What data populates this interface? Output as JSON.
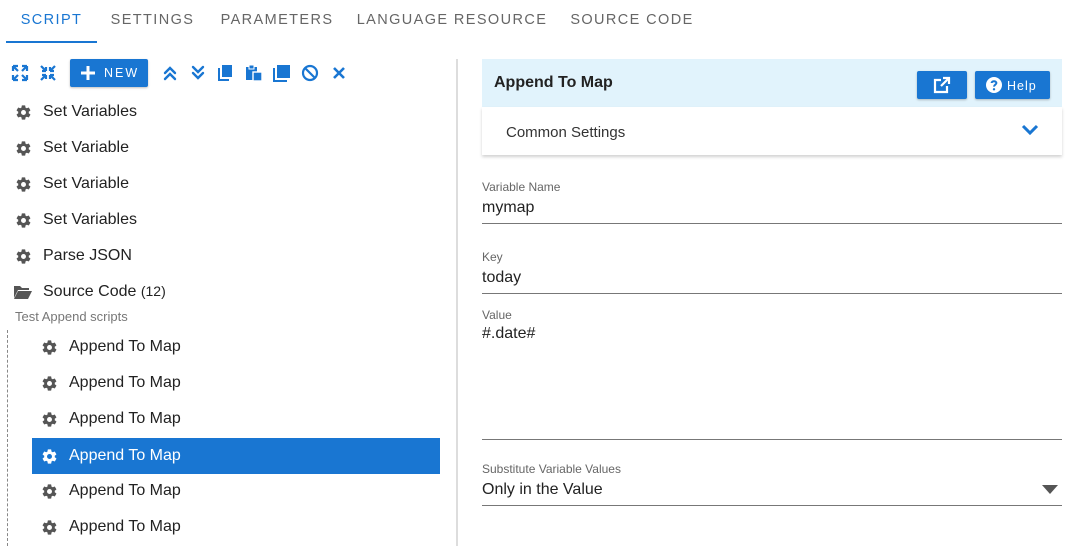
{
  "tabs": [
    {
      "label": "SCRIPT",
      "active": true
    },
    {
      "label": "SETTINGS"
    },
    {
      "label": "PARAMETERS"
    },
    {
      "label": "LANGUAGE RESOURCE"
    },
    {
      "label": "SOURCE CODE"
    }
  ],
  "toolbar": {
    "new_label": "NEW",
    "accent_color": "#1976d2",
    "icons": [
      "expand-all-icon",
      "collapse-all-icon",
      "move-up-icon",
      "move-down-icon",
      "copy-icon",
      "paste-icon",
      "duplicate-icon",
      "disable-icon",
      "delete-icon"
    ]
  },
  "tree": {
    "items": [
      {
        "label": "Set Variables",
        "icon": "gear-icon"
      },
      {
        "label": "Set Variable",
        "icon": "gear-icon"
      },
      {
        "label": "Set Variable",
        "icon": "gear-icon"
      },
      {
        "label": "Set Variables",
        "icon": "gear-icon"
      },
      {
        "label": "Parse JSON",
        "icon": "gear-icon"
      }
    ],
    "group": {
      "label": "Source Code",
      "count": "(12)",
      "description": "Test Append scripts",
      "icon": "folder-open-icon"
    },
    "children": [
      {
        "label": "Append To Map",
        "icon": "gear-icon"
      },
      {
        "label": "Append To Map",
        "icon": "gear-icon"
      },
      {
        "label": "Append To Map",
        "icon": "gear-icon"
      },
      {
        "label": "Append To Map",
        "icon": "gear-icon",
        "selected": true
      },
      {
        "label": "Append To Map",
        "icon": "gear-icon"
      },
      {
        "label": "Append To Map",
        "icon": "gear-icon"
      }
    ]
  },
  "panel": {
    "title": "Append To Map",
    "help_label": "Help",
    "common_settings": "Common Settings",
    "header_bg": "#e1f3fc",
    "fields": {
      "variable_name": {
        "label": "Variable Name",
        "value": "mymap"
      },
      "key": {
        "label": "Key",
        "value": "today"
      },
      "value": {
        "label": "Value",
        "value": "#.date#"
      },
      "substitute": {
        "label": "Substitute Variable Values",
        "value": "Only in the Value"
      }
    }
  }
}
